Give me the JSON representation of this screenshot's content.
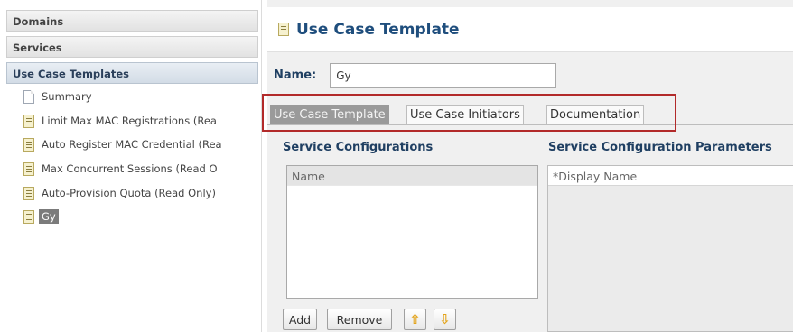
{
  "sidebar": {
    "sections": [
      {
        "label": "Domains"
      },
      {
        "label": "Services"
      },
      {
        "label": "Use Case Templates"
      }
    ],
    "tree": [
      {
        "label": "Summary",
        "icon": "document-icon"
      },
      {
        "label": "Limit Max MAC Registrations (Rea",
        "icon": "template-icon"
      },
      {
        "label": "Auto Register MAC Credential (Rea",
        "icon": "template-icon"
      },
      {
        "label": "Max Concurrent Sessions (Read O",
        "icon": "template-icon"
      },
      {
        "label": "Auto-Provision Quota (Read Only)",
        "icon": "template-icon"
      },
      {
        "label": "Gy",
        "icon": "template-icon",
        "selected": true
      }
    ]
  },
  "main": {
    "title": "Use Case Template",
    "name_label": "Name:",
    "name_value": "Gy",
    "tabs": [
      {
        "label": "Use Case Template",
        "active": true
      },
      {
        "label": "Use Case Initiators"
      },
      {
        "label": "Documentation"
      }
    ],
    "service_configurations": {
      "title": "Service Configurations",
      "column_header": "Name"
    },
    "parameters": {
      "title": "Service Configuration Parameters",
      "column_header": "*Display Name"
    },
    "buttons": {
      "add": "Add",
      "remove": "Remove",
      "move_up": "⇧",
      "move_down": "⇩"
    }
  },
  "colors": {
    "title": "#1f4e7d",
    "highlight_box": "#b22a2a",
    "active_tab": "#9a9a9a",
    "arrow": "#e3a41b"
  }
}
